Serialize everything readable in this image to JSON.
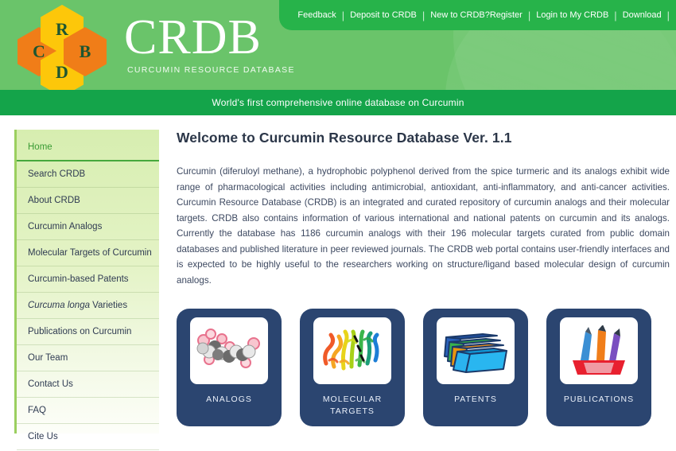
{
  "header": {
    "logo": {
      "hexagons": [
        {
          "letter": "C",
          "color": "#f07d18"
        },
        {
          "letter": "R",
          "color": "#fdc70a"
        },
        {
          "letter": "D",
          "color": "#fdc70a"
        },
        {
          "letter": "B",
          "color": "#f07d18"
        }
      ],
      "title": "CRDB",
      "subtitle": "CURCUMIN RESOURCE DATABASE"
    },
    "nav": [
      {
        "label": "Feedback"
      },
      {
        "label": "Deposit to CRDB"
      },
      {
        "label": "New to CRDB?Register"
      },
      {
        "label": "Login to My CRDB"
      },
      {
        "label": "Download"
      }
    ],
    "separator": "|",
    "colors": {
      "header_green": "#6ac46a",
      "nav_green": "#27b34a",
      "tagline_green": "#14a44a"
    }
  },
  "tagline": {
    "text": "World's first comprehensive online database on Curcumin"
  },
  "sidebar": {
    "items": [
      {
        "label": "Home",
        "active": true
      },
      {
        "label": "Search CRDB",
        "active": false
      },
      {
        "label": "About CRDB",
        "active": false
      },
      {
        "label": "Curcumin Analogs",
        "active": false
      },
      {
        "label": "Molecular Targets of Curcumin",
        "active": false
      },
      {
        "label": "Curcumin-based Patents",
        "active": false
      },
      {
        "label": "Curcuma longa Varieties",
        "active": false,
        "italic_prefix": "Curcuma longa",
        "plain_suffix": " Varieties"
      },
      {
        "label": "Publications on Curcumin",
        "active": false
      },
      {
        "label": "Our Team",
        "active": false
      },
      {
        "label": "Contact Us",
        "active": false
      },
      {
        "label": "FAQ",
        "active": false
      },
      {
        "label": "Cite Us",
        "active": false
      }
    ]
  },
  "main": {
    "heading": "Welcome to Curcumin Resource Database Ver. 1.1",
    "paragraph": "Curcumin (diferuloyl methane), a hydrophobic polyphenol derived from the spice turmeric and its analogs exhibit wide range of pharmacological activities including antimicrobial, antioxidant, anti-inflammatory, and anti-cancer activities. Curcumin Resource Database (CRDB) is an integrated and curated repository of curcumin analogs and their molecular targets. CRDB also contains information of various international and national patents on curcumin and its analogs. Currently the database has 1186 curcumin analogs with their 196 molecular targets curated from public domain databases and published literature in peer reviewed journals. The CRDB web portal contains user-friendly interfaces and is expected to be highly useful to the researchers working on structure/ligand based molecular design of curcumin analogs.",
    "stats": {
      "curcumin_analogs": "1186",
      "molecular_targets": "196",
      "version": "1.1"
    },
    "cards": [
      {
        "label": "ANALOGS",
        "icon": "molecule-spacefill-icon"
      },
      {
        "label": "MOLECULAR TARGETS",
        "icon": "protein-ribbon-icon"
      },
      {
        "label": "PATENTS",
        "icon": "stacked-folders-icon"
      },
      {
        "label": "PUBLICATIONS",
        "icon": "pen-holder-icon"
      }
    ],
    "card_color": "#2b4570"
  }
}
